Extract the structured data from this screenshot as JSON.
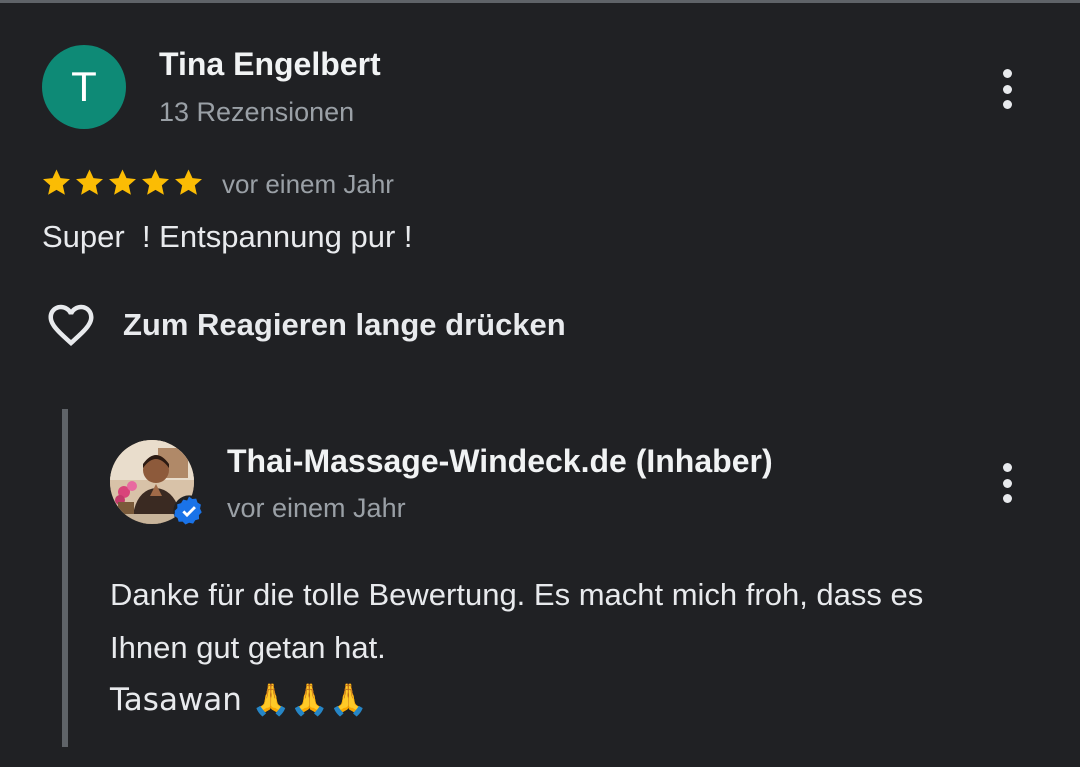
{
  "review": {
    "avatar_letter": "T",
    "author": "Tina Engelbert",
    "review_count": "13 Rezensionen",
    "rating": 5,
    "rating_max": 5,
    "time": "vor einem Jahr",
    "text": "Super  ! Entspannung pur !",
    "react_label": "Zum Reagieren lange drücken",
    "menu_icon": "more-vert-icon"
  },
  "reply": {
    "owner_name": "Thai-Massage-Windeck.de (Inhaber)",
    "time": "vor einem Jahr",
    "verified_icon": "verified-badge-icon",
    "lines": [
      "Danke für die tolle Bewertung. Es macht mich froh, dass es",
      "Ihnen gut getan hat.",
      "Tasawan 🙏🙏🙏"
    ],
    "menu_icon": "more-vert-icon"
  },
  "colors": {
    "background": "#202124",
    "avatar": "#0e8a76",
    "star": "#fbbc04",
    "verified": "#1a73e8",
    "secondary_text": "#9aa0a6"
  }
}
